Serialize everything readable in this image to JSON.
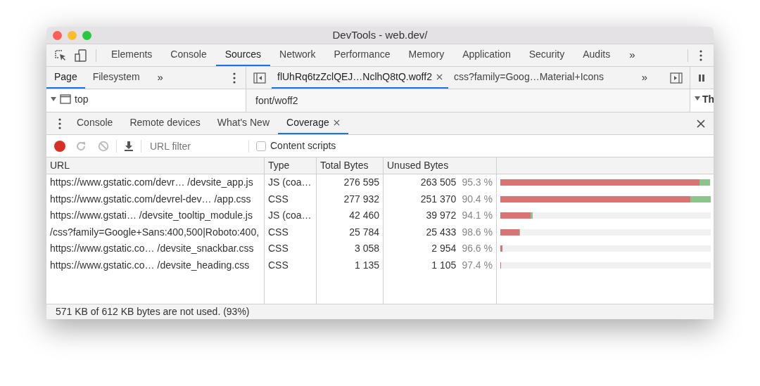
{
  "window": {
    "title": "DevTools - web.dev/"
  },
  "main_tabs": [
    {
      "label": "Elements",
      "selected": false
    },
    {
      "label": "Console",
      "selected": false
    },
    {
      "label": "Sources",
      "selected": true
    },
    {
      "label": "Network",
      "selected": false
    },
    {
      "label": "Performance",
      "selected": false
    },
    {
      "label": "Memory",
      "selected": false
    },
    {
      "label": "Application",
      "selected": false
    },
    {
      "label": "Security",
      "selected": false
    },
    {
      "label": "Audits",
      "selected": false
    }
  ],
  "main_tabs_overflow": "»",
  "navigator": {
    "tabs": [
      {
        "label": "Page",
        "selected": true
      },
      {
        "label": "Filesystem",
        "selected": false
      }
    ],
    "overflow": "»",
    "tree": [
      {
        "label": "top",
        "expanded": true
      }
    ]
  },
  "editor": {
    "tabs": [
      {
        "label": "flUhRq6tzZclQEJ…NclhQ8tQ.woff2",
        "selected": true,
        "closable": true
      },
      {
        "label": "css?family=Goog…Material+Icons",
        "selected": false,
        "closable": false
      }
    ],
    "overflow": "»",
    "content": "font/woff2"
  },
  "sidebar": {
    "section": "Th"
  },
  "drawer": {
    "tabs": [
      {
        "label": "Console",
        "selected": false,
        "closable": false
      },
      {
        "label": "Remote devices",
        "selected": false,
        "closable": false
      },
      {
        "label": "What's New",
        "selected": false,
        "closable": false
      },
      {
        "label": "Coverage",
        "selected": true,
        "closable": true
      }
    ]
  },
  "coverage": {
    "recording": true,
    "url_filter": {
      "placeholder": "URL filter"
    },
    "content_scripts": {
      "label": "Content scripts",
      "checked": false
    },
    "columns": [
      "URL",
      "Type",
      "Total Bytes",
      "Unused Bytes"
    ],
    "rows": [
      {
        "url": "https://www.gstatic.com/devr… /devsite_app.js",
        "type": "JS (coa…",
        "total": "276 595",
        "unused": "263 505",
        "percent": "95.3 %",
        "bar": {
          "level": 0.995
        },
        "unused_bar": {
          "level": 0.948
        }
      },
      {
        "url": "https://www.gstatic.com/devrel-dev… /app.css",
        "type": "CSS",
        "total": "277 932",
        "unused": "251 370",
        "percent": "90.4 %",
        "bar": {
          "level": 1.0
        },
        "unused_bar": {
          "level": 0.904
        }
      },
      {
        "url": "https://www.gstati… /devsite_tooltip_module.js",
        "type": "JS (coa…",
        "total": "42 460",
        "unused": "39 972",
        "percent": "94.1 %",
        "bar": {
          "level": 0.153
        },
        "unused_bar": {
          "level": 0.144
        }
      },
      {
        "url": "/css?family=Google+Sans:400,500|Roboto:400,",
        "type": "CSS",
        "total": "25 784",
        "unused": "25 433",
        "percent": "98.6 %",
        "bar": {
          "level": 0.093
        },
        "unused_bar": {
          "level": 0.09
        }
      },
      {
        "url": "https://www.gstatic.co… /devsite_snackbar.css",
        "type": "CSS",
        "total": "3 058",
        "unused": "2 954",
        "percent": "96.6 %",
        "bar": {
          "level": 0.011
        },
        "unused_bar": {
          "level": 0.011
        }
      },
      {
        "url": "https://www.gstatic.co…  /devsite_heading.css",
        "type": "CSS",
        "total": "1 135",
        "unused": "1 105",
        "percent": "97.4 %",
        "bar": {
          "level": 0.004
        },
        "unused_bar": {
          "level": 0.004
        }
      }
    ],
    "status": "571 KB of 612 KB bytes are not used. (93%)"
  }
}
